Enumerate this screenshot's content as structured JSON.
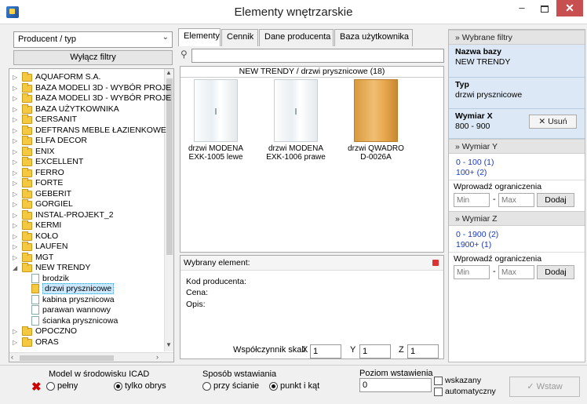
{
  "window": {
    "title": "Elementy wnętrzarskie",
    "minimize": "–",
    "close": "✕"
  },
  "left": {
    "combo_value": "Producent / typ",
    "filters_off_button": "Wyłącz filtry",
    "tree": [
      {
        "label": "AQUAFORM S.A.",
        "level": 0,
        "expanded": false
      },
      {
        "label": "BAZA MODELI 3D - WYBÓR PROJE",
        "level": 0,
        "expanded": false
      },
      {
        "label": "BAZA MODELI 3D - WYBÓR PROJE",
        "level": 0,
        "expanded": false
      },
      {
        "label": "BAZA UŻYTKOWNIKA",
        "level": 0,
        "expanded": false
      },
      {
        "label": "CERSANIT",
        "level": 0,
        "expanded": false
      },
      {
        "label": "DEFTRANS MEBLE ŁAZIENKOWE",
        "level": 0,
        "expanded": false
      },
      {
        "label": "ELFA DECOR",
        "level": 0,
        "expanded": false
      },
      {
        "label": "ENIX",
        "level": 0,
        "expanded": false
      },
      {
        "label": "EXCELLENT",
        "level": 0,
        "expanded": false
      },
      {
        "label": "FERRO",
        "level": 0,
        "expanded": false
      },
      {
        "label": "FORTE",
        "level": 0,
        "expanded": false
      },
      {
        "label": "GEBERIT",
        "level": 0,
        "expanded": false
      },
      {
        "label": "GORGIEL",
        "level": 0,
        "expanded": false
      },
      {
        "label": "INSTAL-PROJEKT_2",
        "level": 0,
        "expanded": false
      },
      {
        "label": "KERMI",
        "level": 0,
        "expanded": false
      },
      {
        "label": "KOŁO",
        "level": 0,
        "expanded": false
      },
      {
        "label": "LAUFEN",
        "level": 0,
        "expanded": false
      },
      {
        "label": "MGT",
        "level": 0,
        "expanded": false
      },
      {
        "label": "NEW TRENDY",
        "level": 0,
        "expanded": true
      },
      {
        "label": "brodzik",
        "level": 1
      },
      {
        "label": "drzwi prysznicowe",
        "level": 1,
        "selected": true
      },
      {
        "label": "kabina prysznicowa",
        "level": 1
      },
      {
        "label": "parawan wannowy",
        "level": 1
      },
      {
        "label": "ścianka prysznicowa",
        "level": 1
      },
      {
        "label": "OPOCZNO",
        "level": 0,
        "expanded": false
      },
      {
        "label": "ORAS",
        "level": 0,
        "expanded": false
      }
    ]
  },
  "tabs": [
    "Elementy",
    "Cennik",
    "Dane producenta",
    "Baza użytkownika"
  ],
  "gallery": {
    "header": "NEW TRENDY / drzwi prysznicowe (18)",
    "items": [
      {
        "line1": "drzwi MODENA",
        "line2": "EXK-1005 lewe",
        "style": "glass"
      },
      {
        "line1": "drzwi MODENA",
        "line2": "EXK-1006 prawe",
        "style": "glass"
      },
      {
        "line1": "drzwi QWADRO",
        "line2": "D-0026A",
        "style": "wood"
      }
    ]
  },
  "details": {
    "header": "Wybrany element:",
    "code_label": "Kod producenta:",
    "price_label": "Cena:",
    "desc_label": "Opis:"
  },
  "scale": {
    "label": "Współczynnik skali",
    "x_label": "X",
    "x": "1",
    "y_label": "Y",
    "y": "1",
    "z_label": "Z",
    "z": "1"
  },
  "sidebar": {
    "header": "Wybrane filtry",
    "filters": [
      {
        "title": "Nazwa bazy",
        "value": "NEW TRENDY"
      },
      {
        "title": "Typ",
        "value": "drzwi prysznicowe"
      },
      {
        "title": "Wymiar X",
        "value": "800 - 900"
      }
    ],
    "remove_button": "✕ Usuń",
    "y": {
      "header": "Wymiar Y",
      "options": [
        "0 - 100  (1)",
        "100+  (2)"
      ],
      "limits_label": "Wprowadź ograniczenia",
      "min_placeholder": "Min",
      "max_placeholder": "Max",
      "add": "Dodaj"
    },
    "z": {
      "header": "Wymiar Z",
      "options": [
        "0 - 1900  (2)",
        "1900+  (1)"
      ],
      "limits_label": "Wprowadź ograniczenia",
      "min_placeholder": "Min",
      "max_placeholder": "Max",
      "add": "Dodaj"
    }
  },
  "bottom": {
    "model_label": "Model w środowisku ICAD",
    "model_opt1": "pełny",
    "model_opt2": "tylko obrys",
    "insert_label": "Sposób wstawiania",
    "insert_opt1": "przy ścianie",
    "insert_opt2": "punkt i kąt",
    "level_label": "Poziom wstawienia",
    "level_value": "0",
    "chk1": "wskazany",
    "chk2": "automatyczny",
    "insert_button": "✓ Wstaw"
  }
}
